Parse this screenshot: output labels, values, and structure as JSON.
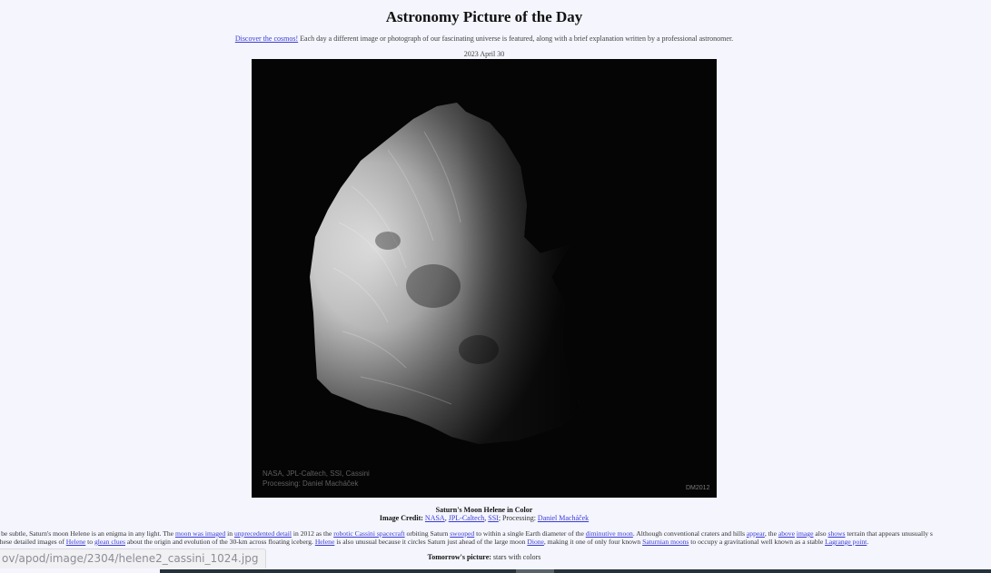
{
  "page": {
    "title": "Astronomy Picture of the Day",
    "tagline_link": "Discover the cosmos!",
    "tagline_text": " Each day a different image or photograph of our fascinating universe is featured, along with a brief explanation written by a professional astronomer.",
    "date": "2023 April 30"
  },
  "image": {
    "watermark_line1": "NASA, JPL-Caltech, SSI, Cassini",
    "watermark_line2": "Processing: Daniel Macháček",
    "signature": "DM2012"
  },
  "caption": {
    "title": "Saturn's Moon Helene in Color",
    "credit_label": "Image Credit:",
    "credit_links": [
      "NASA",
      "JPL-Caltech",
      "SSI"
    ],
    "processing_label": "; Processing: ",
    "processing_link": "Daniel Macháček"
  },
  "explanation": {
    "line1": [
      {
        "t": "ay be subtle, Saturn's moon Helene is an enigma in any light. The "
      },
      {
        "t": "moon was imaged",
        "link": true
      },
      {
        "t": " in "
      },
      {
        "t": "unprecedented detail",
        "link": true
      },
      {
        "t": " in 2012 as the "
      },
      {
        "t": "robotic Cassini spacecraft",
        "link": true
      },
      {
        "t": " orbiting Saturn "
      },
      {
        "t": "swooped",
        "link": true
      },
      {
        "t": " to within a single Earth diameter of the "
      },
      {
        "t": "diminutive moon",
        "link": true
      },
      {
        "t": ". Although conventional craters and hills "
      },
      {
        "t": "appear",
        "link": true
      },
      {
        "t": ", the "
      },
      {
        "t": "above",
        "link": true
      },
      {
        "t": " "
      },
      {
        "t": "image",
        "link": true
      },
      {
        "t": " also "
      },
      {
        "t": "shows",
        "link": true
      },
      {
        "t": " terrain that appears unusually s"
      }
    ],
    "line2": [
      {
        "t": "g these detailed images of "
      },
      {
        "t": "Helene",
        "link": true
      },
      {
        "t": " to "
      },
      {
        "t": "glean clues",
        "link": true
      },
      {
        "t": " about the origin and evolution of the 30-km across floating iceberg. "
      },
      {
        "t": "Helene",
        "link": true
      },
      {
        "t": " is also unusual because it circles Saturn just ahead of the large moon "
      },
      {
        "t": "Dione",
        "link": true
      },
      {
        "t": ", making it one of only four known "
      },
      {
        "t": "Saturnian moons",
        "link": true
      },
      {
        "t": " to occupy a gravitational well known as a stable "
      },
      {
        "t": "Lagrange point",
        "link": true
      },
      {
        "t": "."
      }
    ]
  },
  "tomorrow": {
    "label": "Tomorrow's picture:",
    "text": " stars with colors"
  },
  "status_bar": {
    "url": "ov/apod/image/2304/helene2_cassini_1024.jpg"
  }
}
